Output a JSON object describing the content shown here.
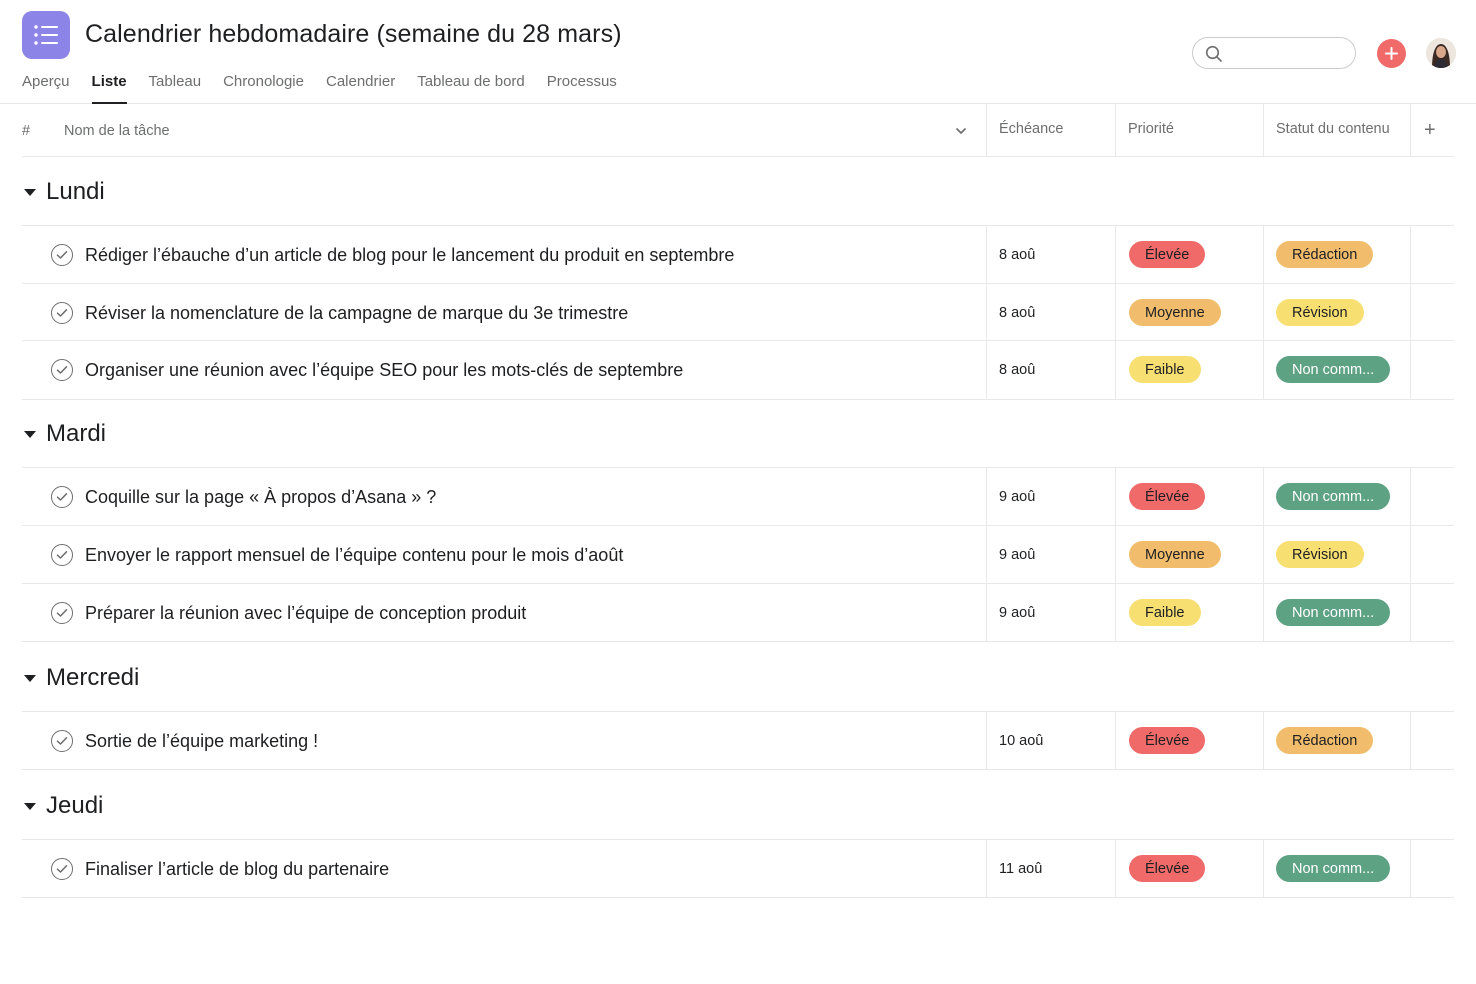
{
  "header": {
    "title": "Calendrier hebdomadaire (semaine du 28 mars)",
    "tabs": [
      "Aperçu",
      "Liste",
      "Tableau",
      "Chronologie",
      "Calendrier",
      "Tableau de bord",
      "Processus"
    ],
    "active_tab": "Liste",
    "search_placeholder": ""
  },
  "columns": {
    "number": "#",
    "task_name": "Nom de la tâche",
    "due": "Échéance",
    "priority": "Priorité",
    "status": "Statut du contenu",
    "add": "+"
  },
  "colors": {
    "app_icon": "#8d84e8",
    "add_button": "#f06a6a",
    "high": "#f06a6a",
    "medium": "#f1bd6c",
    "low": "#f8df72",
    "draft": "#f1bd6c",
    "review": "#f8df72",
    "not_started": "#5da283"
  },
  "sections": [
    {
      "name": "Lundi",
      "tasks": [
        {
          "name": "Rédiger l’ébauche d’un article de blog pour le lancement du produit en septembre",
          "due": "8 aoû",
          "priority": "Élevée",
          "priority_level": "high",
          "status": "Rédaction",
          "status_level": "draft"
        },
        {
          "name": "Réviser la nomenclature de la campagne de marque du 3e trimestre",
          "due": "8 aoû",
          "priority": "Moyenne",
          "priority_level": "medium",
          "status": "Révision",
          "status_level": "review"
        },
        {
          "name": "Organiser une réunion avec l’équipe SEO pour les mots-clés de septembre",
          "due": "8 aoû",
          "priority": "Faible",
          "priority_level": "low",
          "status": "Non comm...",
          "status_level": "not_started"
        }
      ]
    },
    {
      "name": "Mardi",
      "tasks": [
        {
          "name": "Coquille sur la page « À propos d’Asana » ?",
          "due": "9 aoû",
          "priority": "Élevée",
          "priority_level": "high",
          "status": "Non comm...",
          "status_level": "not_started"
        },
        {
          "name": "Envoyer le rapport mensuel de l’équipe contenu pour le mois d’août",
          "due": "9 aoû",
          "priority": "Moyenne",
          "priority_level": "medium",
          "status": "Révision",
          "status_level": "review"
        },
        {
          "name": "Préparer la réunion avec l’équipe de conception produit",
          "due": "9 aoû",
          "priority": "Faible",
          "priority_level": "low",
          "status": "Non comm...",
          "status_level": "not_started"
        }
      ]
    },
    {
      "name": "Mercredi",
      "tasks": [
        {
          "name": "Sortie de l’équipe marketing !",
          "due": "10 aoû",
          "priority": "Élevée",
          "priority_level": "high",
          "status": "Rédaction",
          "status_level": "draft"
        }
      ]
    },
    {
      "name": "Jeudi",
      "tasks": [
        {
          "name": "Finaliser l’article de blog du partenaire",
          "due": "11 aoû",
          "priority": "Élevée",
          "priority_level": "high",
          "status": "Non comm...",
          "status_level": "not_started"
        }
      ]
    }
  ]
}
